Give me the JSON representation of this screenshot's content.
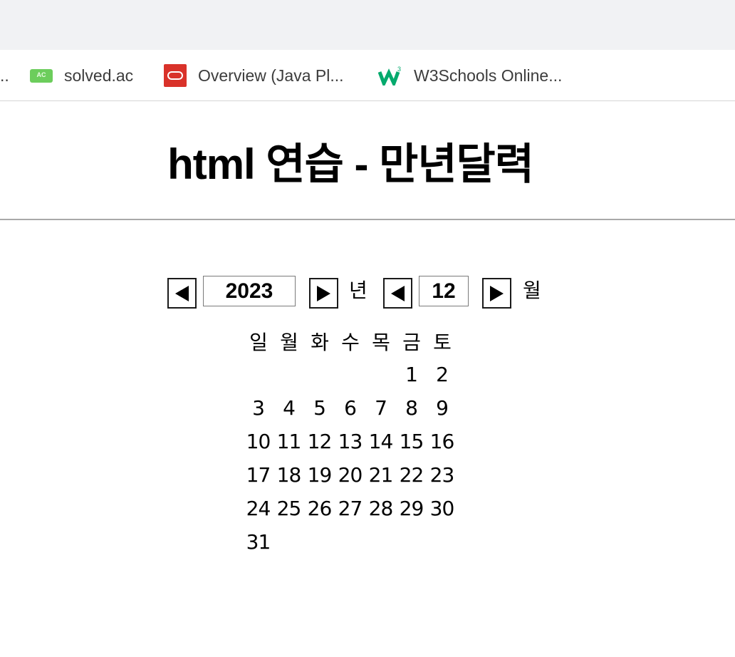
{
  "bookmarks": {
    "overflow_label": "..",
    "items": [
      {
        "label": "solved.ac",
        "icon": "solved-ac-icon"
      },
      {
        "label": "Overview (Java Pl...",
        "icon": "oracle-icon"
      },
      {
        "label": "W3Schools Online...",
        "icon": "w3schools-icon"
      }
    ]
  },
  "page": {
    "title": "html 연습 - 만년달력"
  },
  "controls": {
    "year": "2023",
    "year_unit": "년",
    "month": "12",
    "month_unit": "월",
    "prev_icon": "triangle-left-icon",
    "next_icon": "triangle-right-icon"
  },
  "calendar": {
    "weekdays": [
      "일",
      "월",
      "화",
      "수",
      "목",
      "금",
      "토"
    ],
    "weeks": [
      [
        "",
        "",
        "",
        "",
        "",
        "1",
        "2"
      ],
      [
        "3",
        "4",
        "5",
        "6",
        "7",
        "8",
        "9"
      ],
      [
        "10",
        "11",
        "12",
        "13",
        "14",
        "15",
        "16"
      ],
      [
        "17",
        "18",
        "19",
        "20",
        "21",
        "22",
        "23"
      ],
      [
        "24",
        "25",
        "26",
        "27",
        "28",
        "29",
        "30"
      ],
      [
        "31",
        "",
        "",
        "",
        "",
        "",
        ""
      ]
    ]
  },
  "colors": {
    "tab_strip": "#f1f2f4",
    "solved_ac_green": "#6ccd5c",
    "oracle_red": "#d9322a",
    "w3schools_green": "#04aa6d"
  }
}
